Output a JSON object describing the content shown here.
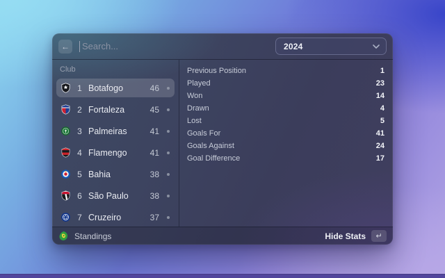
{
  "toolbar": {
    "back_label": "←",
    "search_placeholder": "Search...",
    "season": "2024"
  },
  "clubs_panel": {
    "header": "Club",
    "clubs": [
      {
        "pos": "1",
        "name": "Botafogo",
        "points": "46",
        "crest": "botafogo",
        "selected": true
      },
      {
        "pos": "2",
        "name": "Fortaleza",
        "points": "45",
        "crest": "fortaleza",
        "selected": false
      },
      {
        "pos": "3",
        "name": "Palmeiras",
        "points": "41",
        "crest": "palmeiras",
        "selected": false
      },
      {
        "pos": "4",
        "name": "Flamengo",
        "points": "41",
        "crest": "flamengo",
        "selected": false
      },
      {
        "pos": "5",
        "name": "Bahia",
        "points": "38",
        "crest": "bahia",
        "selected": false
      },
      {
        "pos": "6",
        "name": "São Paulo",
        "points": "38",
        "crest": "sao-paulo",
        "selected": false
      },
      {
        "pos": "7",
        "name": "Cruzeiro",
        "points": "37",
        "crest": "cruzeiro",
        "selected": false
      }
    ]
  },
  "stats_panel": {
    "stats": [
      {
        "label": "Previous Position",
        "value": "1"
      },
      {
        "label": "Played",
        "value": "23"
      },
      {
        "label": "Won",
        "value": "14"
      },
      {
        "label": "Drawn",
        "value": "4"
      },
      {
        "label": "Lost",
        "value": "5"
      },
      {
        "label": "Goals For",
        "value": "41"
      },
      {
        "label": "Goals Against",
        "value": "24"
      },
      {
        "label": "Goal Difference",
        "value": "17"
      }
    ]
  },
  "footer": {
    "title": "Standings",
    "action_label": "Hide Stats",
    "action_key": "↵",
    "league_icon": "brasileirao-logo"
  },
  "colors": {
    "selection": "rgba(255,255,255,0.16)",
    "bg_top_left": "#8cd7f0",
    "bg_top_right": "#3442c8",
    "bg_bottom_right": "#b3a5e4",
    "bg_bottom_strip": "#51459c",
    "window_base": "#3d4460"
  }
}
